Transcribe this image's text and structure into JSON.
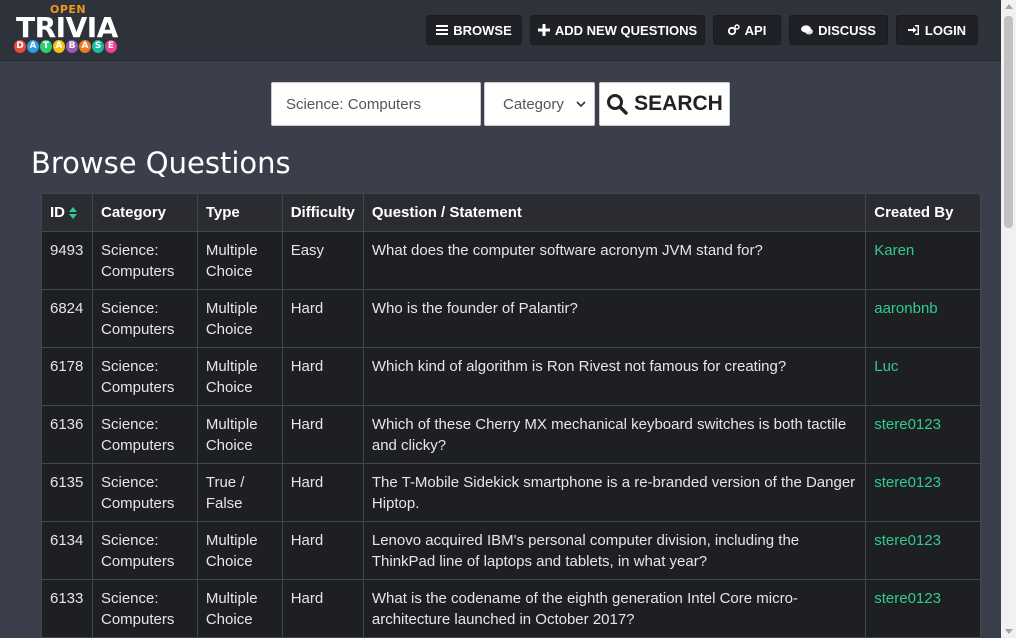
{
  "brand": {
    "open": "OPEN",
    "trivia": "TRIVIA",
    "database_letters": [
      "D",
      "A",
      "T",
      "A",
      "B",
      "A",
      "S",
      "E"
    ],
    "database_colors": [
      "#e84c3d",
      "#3498db",
      "#2ecc71",
      "#f1c40f",
      "#9b59b6",
      "#e67e22",
      "#1abc9c",
      "#e84393"
    ]
  },
  "nav": {
    "browse": "BROWSE",
    "add": "ADD NEW QUESTIONS",
    "api": "API",
    "discuss": "DISCUSS",
    "login": "LOGIN"
  },
  "search": {
    "query": "Science: Computers",
    "category_label": "Category",
    "button_label": "SEARCH"
  },
  "page_title": "Browse Questions",
  "table": {
    "headers": {
      "id": "ID",
      "category": "Category",
      "type": "Type",
      "difficulty": "Difficulty",
      "question": "Question / Statement",
      "created_by": "Created By"
    },
    "rows": [
      {
        "id": "9493",
        "category": "Science: Computers",
        "type": "Multiple Choice",
        "difficulty": "Easy",
        "question": "What does the computer software acronym JVM stand for?",
        "created_by": "Karen"
      },
      {
        "id": "6824",
        "category": "Science: Computers",
        "type": "Multiple Choice",
        "difficulty": "Hard",
        "question": "Who is the founder of Palantir?",
        "created_by": "aaronbnb"
      },
      {
        "id": "6178",
        "category": "Science: Computers",
        "type": "Multiple Choice",
        "difficulty": "Hard",
        "question": "Which kind of algorithm is Ron Rivest not famous for creating?",
        "created_by": "Luc"
      },
      {
        "id": "6136",
        "category": "Science: Computers",
        "type": "Multiple Choice",
        "difficulty": "Hard",
        "question": "Which of these Cherry MX mechanical keyboard switches is both tactile and clicky?",
        "created_by": "stere0123"
      },
      {
        "id": "6135",
        "category": "Science: Computers",
        "type": "True / False",
        "difficulty": "Hard",
        "question": "The T-Mobile Sidekick smartphone is a re-branded version of the Danger Hiptop.",
        "created_by": "stere0123"
      },
      {
        "id": "6134",
        "category": "Science: Computers",
        "type": "Multiple Choice",
        "difficulty": "Hard",
        "question": "Lenovo acquired IBM's personal computer division, including the ThinkPad line of laptops and tablets, in what year?",
        "created_by": "stere0123"
      },
      {
        "id": "6133",
        "category": "Science: Computers",
        "type": "Multiple Choice",
        "difficulty": "Hard",
        "question": "What is the codename of the eighth generation Intel Core micro-architecture launched in October 2017?",
        "created_by": "stere0123"
      }
    ]
  },
  "colors": {
    "accent_user_link": "#2ecc8f",
    "brand_orange": "#f29a1f",
    "sort_icon": "#2ecc8f"
  }
}
